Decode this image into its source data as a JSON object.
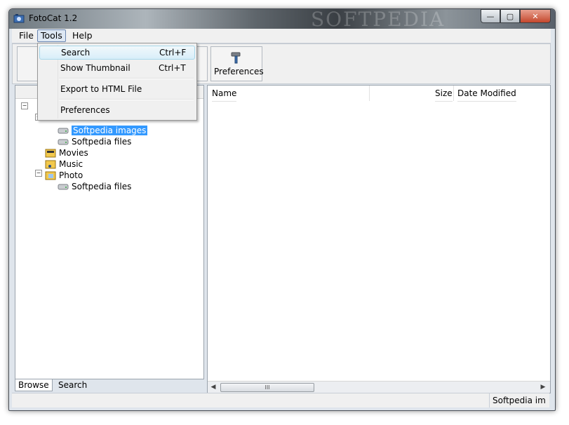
{
  "window": {
    "title": "FotoCat 1.2",
    "watermark": "SOFTPEDIA"
  },
  "title_buttons": {
    "minimize": "—",
    "maximize": "▢",
    "close": "✕"
  },
  "menubar": {
    "file": "File",
    "tools": "Tools",
    "help": "Help"
  },
  "toolbar": {
    "preferences_label": "Preferences"
  },
  "tools_menu": {
    "items": [
      {
        "label": "Search",
        "shortcut": "Ctrl+F"
      },
      {
        "label": "Show Thumbnail",
        "shortcut": "Ctrl+T"
      },
      {
        "label": "Export to HTML File",
        "shortcut": ""
      },
      {
        "label": "Preferences",
        "shortcut": ""
      }
    ]
  },
  "tree": {
    "items": [
      {
        "label": "Softpedia images",
        "icon": "drive-icon",
        "selected": true
      },
      {
        "label": "Softpedia files",
        "icon": "drive-icon"
      },
      {
        "label": "Movies",
        "icon": "film-folder-icon"
      },
      {
        "label": "Music",
        "icon": "music-folder-icon"
      },
      {
        "label": "Photo",
        "icon": "photo-folder-icon"
      },
      {
        "label": "Softpedia files",
        "icon": "drive-icon"
      }
    ]
  },
  "left_tabs": {
    "browse": "Browse",
    "search": "Search"
  },
  "file_list": {
    "columns": {
      "name": "Name",
      "size": "Size",
      "date": "Date Modified"
    }
  },
  "scrollbar": {
    "thumb_grip": "III"
  },
  "statusbar": {
    "text": "Softpedia im"
  }
}
